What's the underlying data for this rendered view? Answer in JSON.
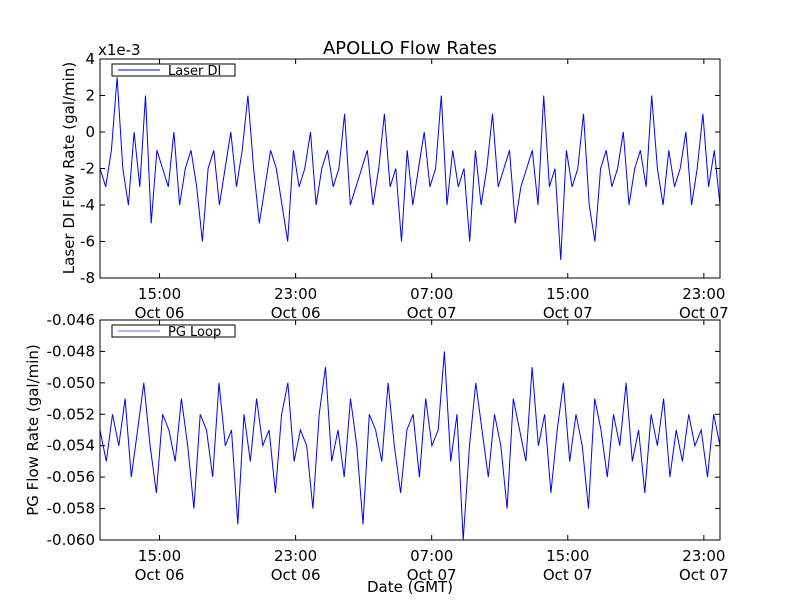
{
  "chart_data": [
    {
      "type": "line",
      "title": "APOLLO Flow Rates",
      "ylabel": "Laser DI Flow Rate (gal/min)",
      "xlabel": "",
      "offset_label": "x1e-3",
      "legend": {
        "entries": [
          "Laser DI"
        ],
        "placement": "top-left"
      },
      "color": "#0000ff",
      "x_range": [
        "Oct 06 11:30",
        "Oct 07 23:57"
      ],
      "xlim_hours": [
        0,
        36.45
      ],
      "xticks": [
        {
          "hours": 3.5,
          "time": "15:00",
          "date": "Oct 06"
        },
        {
          "hours": 11.5,
          "time": "23:00",
          "date": "Oct 06"
        },
        {
          "hours": 19.5,
          "time": "07:00",
          "date": "Oct 07"
        },
        {
          "hours": 27.5,
          "time": "15:00",
          "date": "Oct 07"
        },
        {
          "hours": 35.5,
          "time": "23:00",
          "date": "Oct 07"
        }
      ],
      "ylim": [
        -8,
        4
      ],
      "yticks": [
        4,
        2,
        0,
        -2,
        -4,
        -6,
        -8
      ],
      "ytick_labels": [
        "4",
        "2",
        "0",
        "-2",
        "-4",
        "-6",
        "-8"
      ],
      "values": [
        -2,
        -3,
        -1,
        3,
        -2,
        -4,
        0,
        -3,
        2,
        -5,
        -1,
        -2,
        -3,
        0,
        -4,
        -2,
        -1,
        -3,
        -6,
        -2,
        -1,
        -4,
        -2,
        0,
        -3,
        -1,
        2,
        -2,
        -5,
        -3,
        -1,
        -2,
        -4,
        -6,
        -1,
        -3,
        -2,
        0,
        -4,
        -2,
        -1,
        -3,
        -2,
        1,
        -4,
        -3,
        -2,
        -1,
        -4,
        -2,
        1,
        -3,
        -2,
        -6,
        -1,
        -4,
        -2,
        0,
        -3,
        -2,
        2,
        -4,
        -1,
        -3,
        -2,
        -6,
        -1,
        -4,
        -2,
        1,
        -3,
        -2,
        -1,
        -5,
        -3,
        -2,
        -1,
        -4,
        2,
        -3,
        -2,
        -7,
        -1,
        -3,
        -2,
        1,
        -4,
        -6,
        -2,
        -1,
        -3,
        -2,
        0,
        -4,
        -2,
        -1,
        -3,
        2,
        -2,
        -4,
        -1,
        -3,
        -2,
        0,
        -4,
        -2,
        1,
        -3,
        -1,
        -4
      ]
    },
    {
      "type": "line",
      "title": "",
      "ylabel": "PG Flow Rate (gal/min)",
      "xlabel": "Date (GMT)",
      "legend": {
        "entries": [
          "PG Loop"
        ],
        "placement": "top-left"
      },
      "color": "#0000ff",
      "x_range": [
        "Oct 06 11:30",
        "Oct 07 23:57"
      ],
      "xlim_hours": [
        0,
        36.45
      ],
      "xticks": [
        {
          "hours": 3.5,
          "time": "15:00",
          "date": "Oct 06"
        },
        {
          "hours": 11.5,
          "time": "23:00",
          "date": "Oct 06"
        },
        {
          "hours": 19.5,
          "time": "07:00",
          "date": "Oct 07"
        },
        {
          "hours": 27.5,
          "time": "15:00",
          "date": "Oct 07"
        },
        {
          "hours": 35.5,
          "time": "23:00",
          "date": "Oct 07"
        }
      ],
      "ylim": [
        -0.06,
        -0.046
      ],
      "yticks": [
        -0.046,
        -0.048,
        -0.05,
        -0.052,
        -0.054,
        -0.056,
        -0.058,
        -0.06
      ],
      "ytick_labels": [
        "-0.046",
        "-0.048",
        "-0.050",
        "-0.052",
        "-0.054",
        "-0.056",
        "-0.058",
        "-0.060"
      ],
      "values": [
        -0.053,
        -0.055,
        -0.052,
        -0.054,
        -0.051,
        -0.056,
        -0.053,
        -0.05,
        -0.054,
        -0.057,
        -0.052,
        -0.053,
        -0.055,
        -0.051,
        -0.054,
        -0.058,
        -0.052,
        -0.053,
        -0.056,
        -0.05,
        -0.054,
        -0.053,
        -0.059,
        -0.052,
        -0.055,
        -0.051,
        -0.054,
        -0.053,
        -0.057,
        -0.052,
        -0.05,
        -0.055,
        -0.053,
        -0.054,
        -0.058,
        -0.052,
        -0.049,
        -0.055,
        -0.053,
        -0.056,
        -0.051,
        -0.054,
        -0.059,
        -0.052,
        -0.053,
        -0.055,
        -0.05,
        -0.054,
        -0.057,
        -0.053,
        -0.052,
        -0.056,
        -0.051,
        -0.054,
        -0.053,
        -0.048,
        -0.055,
        -0.052,
        -0.06,
        -0.054,
        -0.05,
        -0.053,
        -0.056,
        -0.052,
        -0.054,
        -0.058,
        -0.051,
        -0.053,
        -0.055,
        -0.049,
        -0.054,
        -0.052,
        -0.057,
        -0.053,
        -0.05,
        -0.055,
        -0.052,
        -0.054,
        -0.058,
        -0.051,
        -0.053,
        -0.056,
        -0.052,
        -0.054,
        -0.05,
        -0.055,
        -0.053,
        -0.057,
        -0.052,
        -0.054,
        -0.051,
        -0.056,
        -0.053,
        -0.055,
        -0.052,
        -0.054,
        -0.053,
        -0.056,
        -0.052,
        -0.054
      ]
    }
  ]
}
